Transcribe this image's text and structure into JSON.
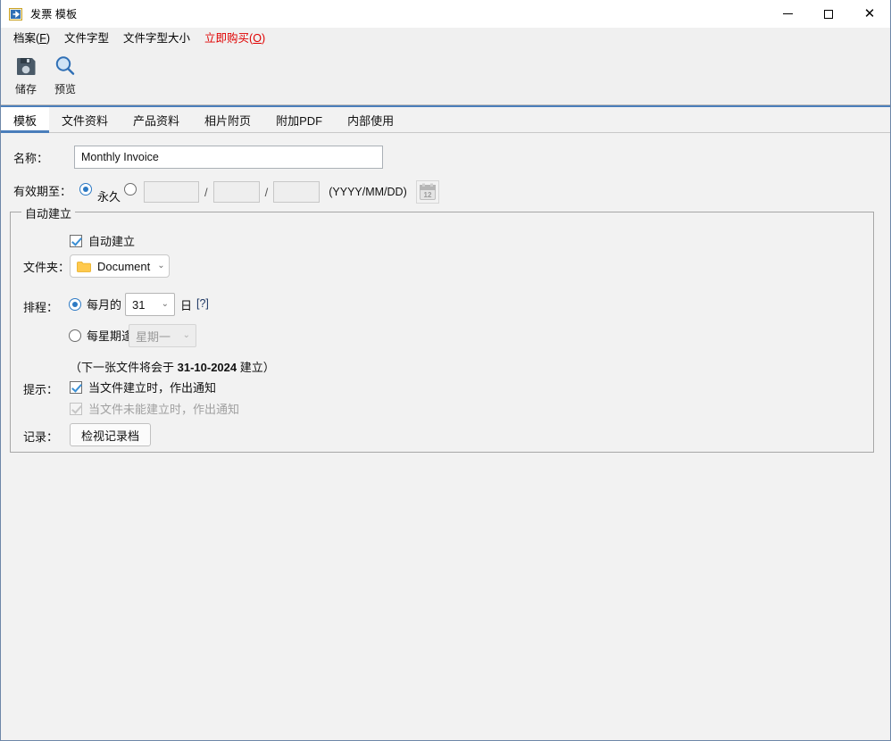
{
  "window": {
    "title": "发票 模板",
    "app_icon": "document-export-icon",
    "minimize_label": "—",
    "maximize_label": "□",
    "close_label": "✕"
  },
  "menubar": {
    "items": [
      {
        "label": "档案(F)",
        "text": "档案",
        "mnemonic": "F",
        "accent": false
      },
      {
        "label": "文件字型",
        "text": "文件字型",
        "mnemonic": "",
        "accent": false
      },
      {
        "label": "文件字型大小",
        "text": "文件字型大小",
        "mnemonic": "",
        "accent": false
      },
      {
        "label": "立即购买(O)",
        "text": "立即购买",
        "mnemonic": "O",
        "accent": true
      }
    ]
  },
  "toolbar": {
    "buttons": [
      {
        "label": "储存",
        "icon": "save-floppy-icon"
      },
      {
        "label": "预览",
        "icon": "preview-magnifier-icon"
      }
    ]
  },
  "tabs": {
    "items": [
      {
        "label": "模板",
        "active": true
      },
      {
        "label": "文件资料",
        "active": false
      },
      {
        "label": "产品资料",
        "active": false
      },
      {
        "label": "相片附页",
        "active": false
      },
      {
        "label": "附加PDF",
        "active": false
      },
      {
        "label": "内部使用",
        "active": false
      }
    ]
  },
  "form": {
    "name": {
      "label": "名称：",
      "value": "Monthly Invoice",
      "placeholder": ""
    },
    "validity": {
      "label": "有效期至：",
      "forever_label": "永久",
      "forever_selected": true,
      "custom_selected": false,
      "year": "",
      "month": "",
      "day": "",
      "separator": "/",
      "format_hint": "(YYYY/MM/DD)",
      "calendar_icon": "calendar-icon",
      "calendar_day_text": "12"
    },
    "auto_create_group": {
      "title": "自动建立",
      "enable_checkbox": {
        "label": "自动建立",
        "checked": true,
        "disabled": false
      },
      "folder": {
        "label": "文件夹：",
        "icon": "folder-icon",
        "value": "Document",
        "caret": "⌄"
      },
      "schedule": {
        "label": "排程：",
        "monthly": {
          "selected": true,
          "prefix": "每月的",
          "day_value": "31",
          "suffix": "日",
          "help_link": "[?]",
          "caret": "⌄"
        },
        "weekly": {
          "selected": false,
          "prefix": "每星期逢",
          "day_value": "星期一",
          "disabled": true,
          "caret": "⌄"
        }
      },
      "next_note": {
        "prefix": "（下一张文件将会于 ",
        "date": "31-10-2024",
        "suffix": " 建立）"
      },
      "notify": {
        "label": "提示：",
        "on_created": {
          "label": "当文件建立时，作出通知",
          "checked": true,
          "disabled": false
        },
        "on_failed": {
          "label": "当文件未能建立时，作出通知",
          "checked": true,
          "disabled": true
        }
      },
      "log": {
        "label": "记录：",
        "button_label": "检视记录档"
      }
    }
  },
  "colors": {
    "accent_blue": "#4a7ebb",
    "menu_accent_red": "#e00000",
    "radio_blue": "#2d7ac4",
    "check_blue": "#3a8fd4",
    "link_navy": "#1f3864",
    "folder_yellow": "#ffc94d",
    "window_border": "#6e87a8"
  }
}
